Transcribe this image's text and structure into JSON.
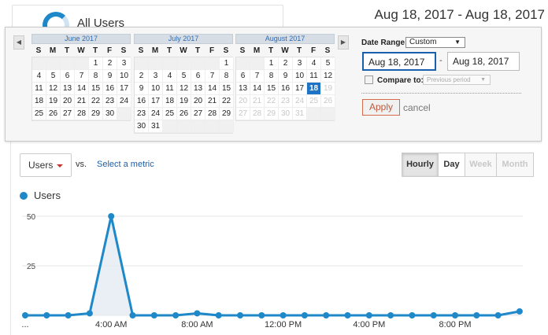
{
  "segment": {
    "label": "All Users"
  },
  "header": {
    "date_range": "Aug 18, 2017 - Aug 18, 2017"
  },
  "picker": {
    "prev_arrow": "◀",
    "next_arrow": "▶",
    "weekday_headers": [
      "S",
      "M",
      "T",
      "W",
      "T",
      "F",
      "S"
    ],
    "calendars": [
      {
        "month": "June 2017",
        "weeks": [
          [
            "",
            "",
            "",
            "",
            "1",
            "2",
            "3"
          ],
          [
            "4",
            "5",
            "6",
            "7",
            "8",
            "9",
            "10"
          ],
          [
            "11",
            "12",
            "13",
            "14",
            "15",
            "16",
            "17"
          ],
          [
            "18",
            "19",
            "20",
            "21",
            "22",
            "23",
            "24"
          ],
          [
            "25",
            "26",
            "27",
            "28",
            "29",
            "30",
            ""
          ]
        ]
      },
      {
        "month": "July 2017",
        "weeks": [
          [
            "",
            "",
            "",
            "",
            "",
            "",
            "1"
          ],
          [
            "2",
            "3",
            "4",
            "5",
            "6",
            "7",
            "8"
          ],
          [
            "9",
            "10",
            "11",
            "12",
            "13",
            "14",
            "15"
          ],
          [
            "16",
            "17",
            "18",
            "19",
            "20",
            "21",
            "22"
          ],
          [
            "23",
            "24",
            "25",
            "26",
            "27",
            "28",
            "29"
          ],
          [
            "30",
            "31",
            "",
            "",
            "",
            "",
            ""
          ]
        ]
      },
      {
        "month": "August 2017",
        "selected_day": "18",
        "future_after": 18,
        "weeks": [
          [
            "",
            "",
            "1",
            "2",
            "3",
            "4",
            "5"
          ],
          [
            "6",
            "7",
            "8",
            "9",
            "10",
            "11",
            "12"
          ],
          [
            "13",
            "14",
            "15",
            "16",
            "17",
            "18",
            "19"
          ],
          [
            "20",
            "21",
            "22",
            "23",
            "24",
            "25",
            "26"
          ],
          [
            "27",
            "28",
            "29",
            "30",
            "31",
            "",
            ""
          ]
        ]
      }
    ],
    "date_range_label": "Date Range:",
    "date_range_value": "Custom",
    "start_date": "Aug 18, 2017",
    "end_date": "Aug 18, 2017",
    "dash": "-",
    "compare_label": "Compare to:",
    "compare_value": "Previous period",
    "apply_label": "Apply",
    "cancel_label": "cancel"
  },
  "toolbar": {
    "metric_label": "Users",
    "vs_label": "vs.",
    "select_metric_label": "Select a metric",
    "granularity": [
      "Hourly",
      "Day",
      "Week",
      "Month"
    ],
    "granularity_active": "Hourly"
  },
  "legend": {
    "label": "Users"
  },
  "colors": {
    "series": "#1e88c8",
    "accent": "#1a5fae",
    "apply_border": "#d46b4b"
  },
  "chart_data": {
    "type": "line",
    "title": "",
    "series": [
      {
        "name": "Users",
        "x": [
          "12:00 AM",
          "1:00 AM",
          "2:00 AM",
          "3:00 AM",
          "4:00 AM",
          "5:00 AM",
          "6:00 AM",
          "7:00 AM",
          "8:00 AM",
          "9:00 AM",
          "10:00 AM",
          "11:00 AM",
          "12:00 PM",
          "1:00 PM",
          "2:00 PM",
          "3:00 PM",
          "4:00 PM",
          "5:00 PM",
          "6:00 PM",
          "7:00 PM",
          "8:00 PM",
          "9:00 PM",
          "10:00 PM",
          "11:00 PM"
        ],
        "values": [
          0,
          0,
          0,
          1,
          50,
          0,
          0,
          0,
          1,
          0,
          0,
          0,
          0,
          0,
          0,
          0,
          0,
          0,
          0,
          0,
          0,
          0,
          0,
          2
        ]
      }
    ],
    "x_tick_labels": [
      "...",
      "4:00 AM",
      "8:00 AM",
      "12:00 PM",
      "4:00 PM",
      "8:00 PM"
    ],
    "y_tick_labels": [
      "50",
      "25"
    ],
    "ylim": [
      0,
      50
    ],
    "grid": true,
    "legend": "top-left"
  }
}
